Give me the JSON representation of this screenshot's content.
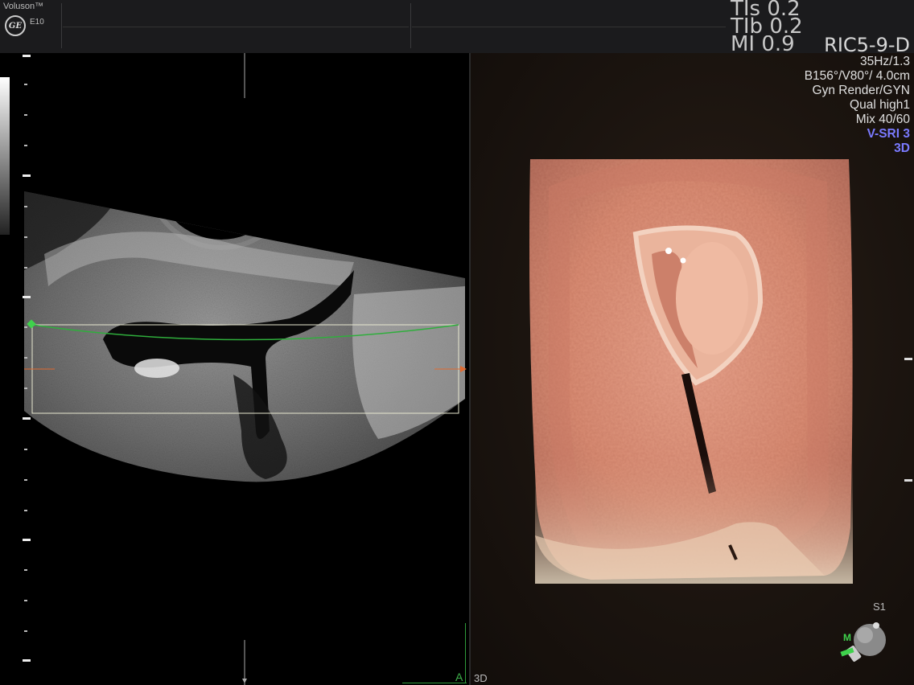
{
  "header": {
    "brand": "Voluson™",
    "model": "E10",
    "logo_text": "GE",
    "indices": [
      {
        "name": "TIs",
        "value": "0.2"
      },
      {
        "name": "TIb",
        "value": "0.2"
      },
      {
        "name": "MI",
        "value": "0.9"
      }
    ]
  },
  "info": {
    "probe": "RIC5-9-D",
    "lines": [
      "35Hz/1.3",
      "B156°/V80°/ 4.0cm",
      "Gyn Render/GYN",
      "Qual high1",
      "Mix 40/60"
    ],
    "highlight_lines": [
      "V-SRI 3",
      "3D"
    ]
  },
  "labels": {
    "a": "A",
    "render_mode": "3D",
    "orientation_s": "S1",
    "orientation_m": "M"
  },
  "colors": {
    "accent_green": "#3fb24c",
    "marker_orange": "#e06a30",
    "vsri_blue": "#7a7aff"
  },
  "icons": {
    "logo": "ge-logo-icon",
    "orientation": "orientation-sphere-icon"
  }
}
